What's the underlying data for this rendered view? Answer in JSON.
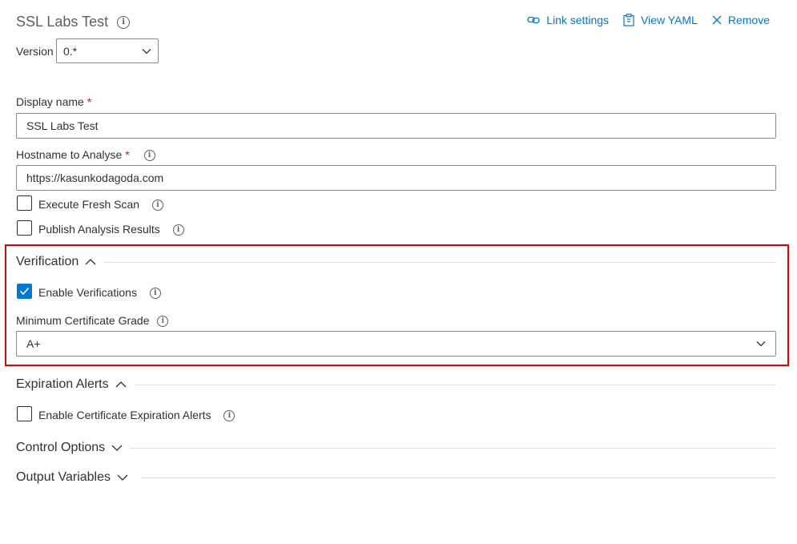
{
  "task": {
    "title": "SSL Labs Test",
    "version_label": "Version",
    "version_value": "0.*"
  },
  "toolbar": {
    "link_settings": "Link settings",
    "view_yaml": "View YAML",
    "remove": "Remove"
  },
  "fields": {
    "display_name": {
      "label": "Display name",
      "required": "*",
      "value": "SSL Labs Test"
    },
    "hostname": {
      "label": "Hostname to Analyse",
      "required": "*",
      "value": "https://kasunkodagoda.com"
    },
    "fresh_scan": {
      "label": "Execute Fresh Scan",
      "checked": false
    },
    "publish_results": {
      "label": "Publish Analysis Results",
      "checked": false
    }
  },
  "sections": {
    "verification": {
      "title": "Verification",
      "enable_label": "Enable Verifications",
      "enable_checked": true,
      "grade_label": "Minimum Certificate Grade",
      "grade_value": "A+"
    },
    "expiration": {
      "title": "Expiration Alerts",
      "enable_label": "Enable Certificate Expiration Alerts",
      "enable_checked": false
    },
    "control_options": {
      "title": "Control Options"
    },
    "output_variables": {
      "title": "Output Variables"
    }
  },
  "colors": {
    "accent": "#0078d4",
    "highlight": "#e00000",
    "required": "#a4262c"
  },
  "icons": [
    "info-icon",
    "link-icon",
    "clipboard-icon",
    "close-icon",
    "chevron-down-icon",
    "chevron-up-icon",
    "checkmark-icon"
  ]
}
